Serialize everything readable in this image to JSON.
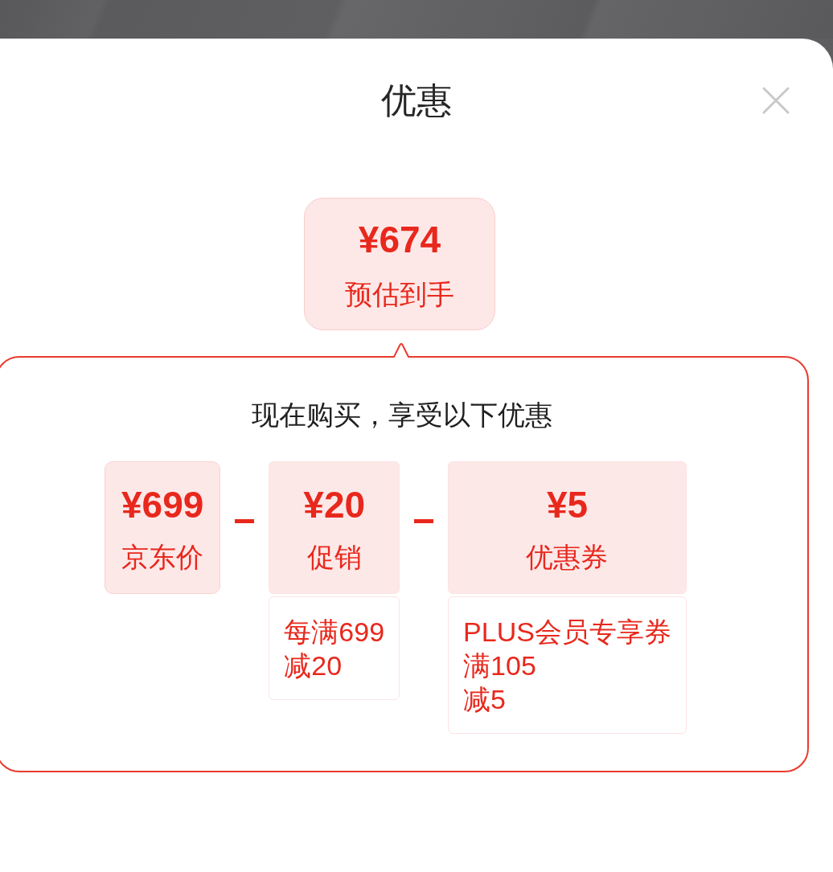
{
  "sheet": {
    "title": "优惠"
  },
  "estimate": {
    "price": "¥674",
    "label": "预估到手"
  },
  "offers": {
    "headline": "现在购买，享受以下优惠",
    "items": [
      {
        "kind": "base",
        "price": "¥699",
        "label": "京东价"
      },
      {
        "kind": "discount",
        "price": "¥20",
        "label": "促销",
        "detail_lines": [
          "每满699",
          "减20"
        ]
      },
      {
        "kind": "discount",
        "price": "¥5",
        "label": "优惠券",
        "detail_lines": [
          "PLUS会员专享券",
          "满105",
          "减5"
        ]
      }
    ]
  }
}
